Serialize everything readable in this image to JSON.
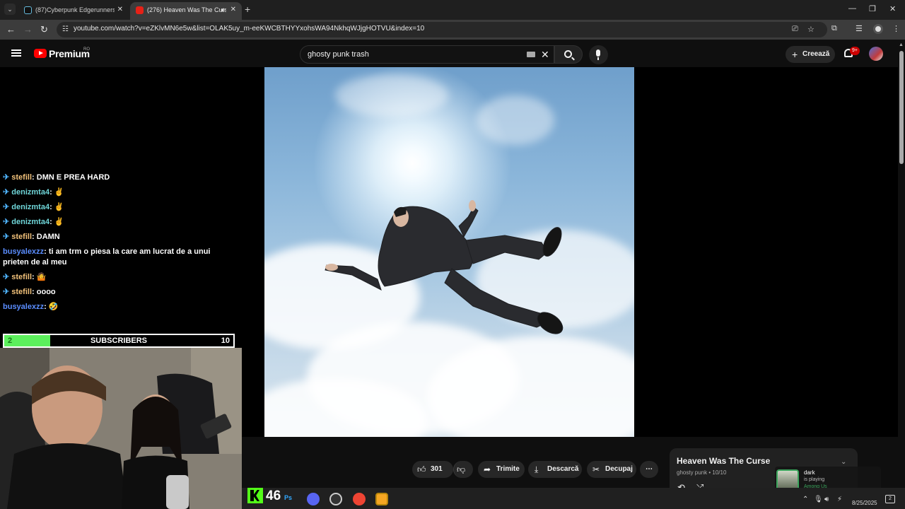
{
  "browser": {
    "tabs": [
      {
        "title": "(87)Cyberpunk Edgerunners: A"
      },
      {
        "title": "(276) Heaven Was The Curs"
      }
    ],
    "url": "youtube.com/watch?v=eZKlvMN6e5w&list=OLAK5uy_m-eeKWCBTHYYxohsWA94NkhqWJjgHOTVU&index=10"
  },
  "youtube": {
    "logo_text": "Premium",
    "country": "RO",
    "search_query": "ghosty punk trash",
    "create_label": "Creează",
    "notification_count": "9+"
  },
  "chat": {
    "messages": [
      {
        "user": "stefill",
        "text": "DMN E PREA HARD",
        "pinned": true,
        "color": "#f3c27a"
      },
      {
        "user": "denizmta4",
        "text": "✌",
        "pinned": true,
        "color": "#6fd6d9"
      },
      {
        "user": "denizmta4",
        "text": "✌",
        "pinned": true,
        "color": "#6fd6d9"
      },
      {
        "user": "denizmta4",
        "text": "✌",
        "pinned": true,
        "color": "#6fd6d9"
      },
      {
        "user": "stefill",
        "text": "DAMN",
        "pinned": true,
        "color": "#f3c27a"
      },
      {
        "user": "busyalexzz",
        "text": "ti am trm o piesa la care am lucrat de a unui prieten de al meu",
        "pinned": false,
        "color": "#5a8dff"
      },
      {
        "user": "stefill",
        "text": "🤷",
        "pinned": true,
        "color": "#f3c27a"
      },
      {
        "user": "stefill",
        "text": "oooo",
        "pinned": true,
        "color": "#f3c27a"
      },
      {
        "user": "busyalexzz",
        "text": "🤣",
        "pinned": false,
        "color": "#5a8dff"
      }
    ]
  },
  "subscribers": {
    "current": "2",
    "label": "SUBSCRIBERS",
    "goal": "10",
    "progress": 0.2
  },
  "actions": {
    "likes": "301",
    "share": "Trimite",
    "download": "Descarcă",
    "clip": "Decupaj",
    "more": "⋯"
  },
  "now_playing": {
    "title": "Heaven Was The Curse",
    "artist_position": "ghosty punk • 10/10"
  },
  "discord": {
    "name": "dark",
    "status": "is playing",
    "game": "Among Us"
  },
  "stream": {
    "viewers": "46"
  },
  "taskbar": {
    "date": "8/25/2025",
    "notifications": "2"
  }
}
